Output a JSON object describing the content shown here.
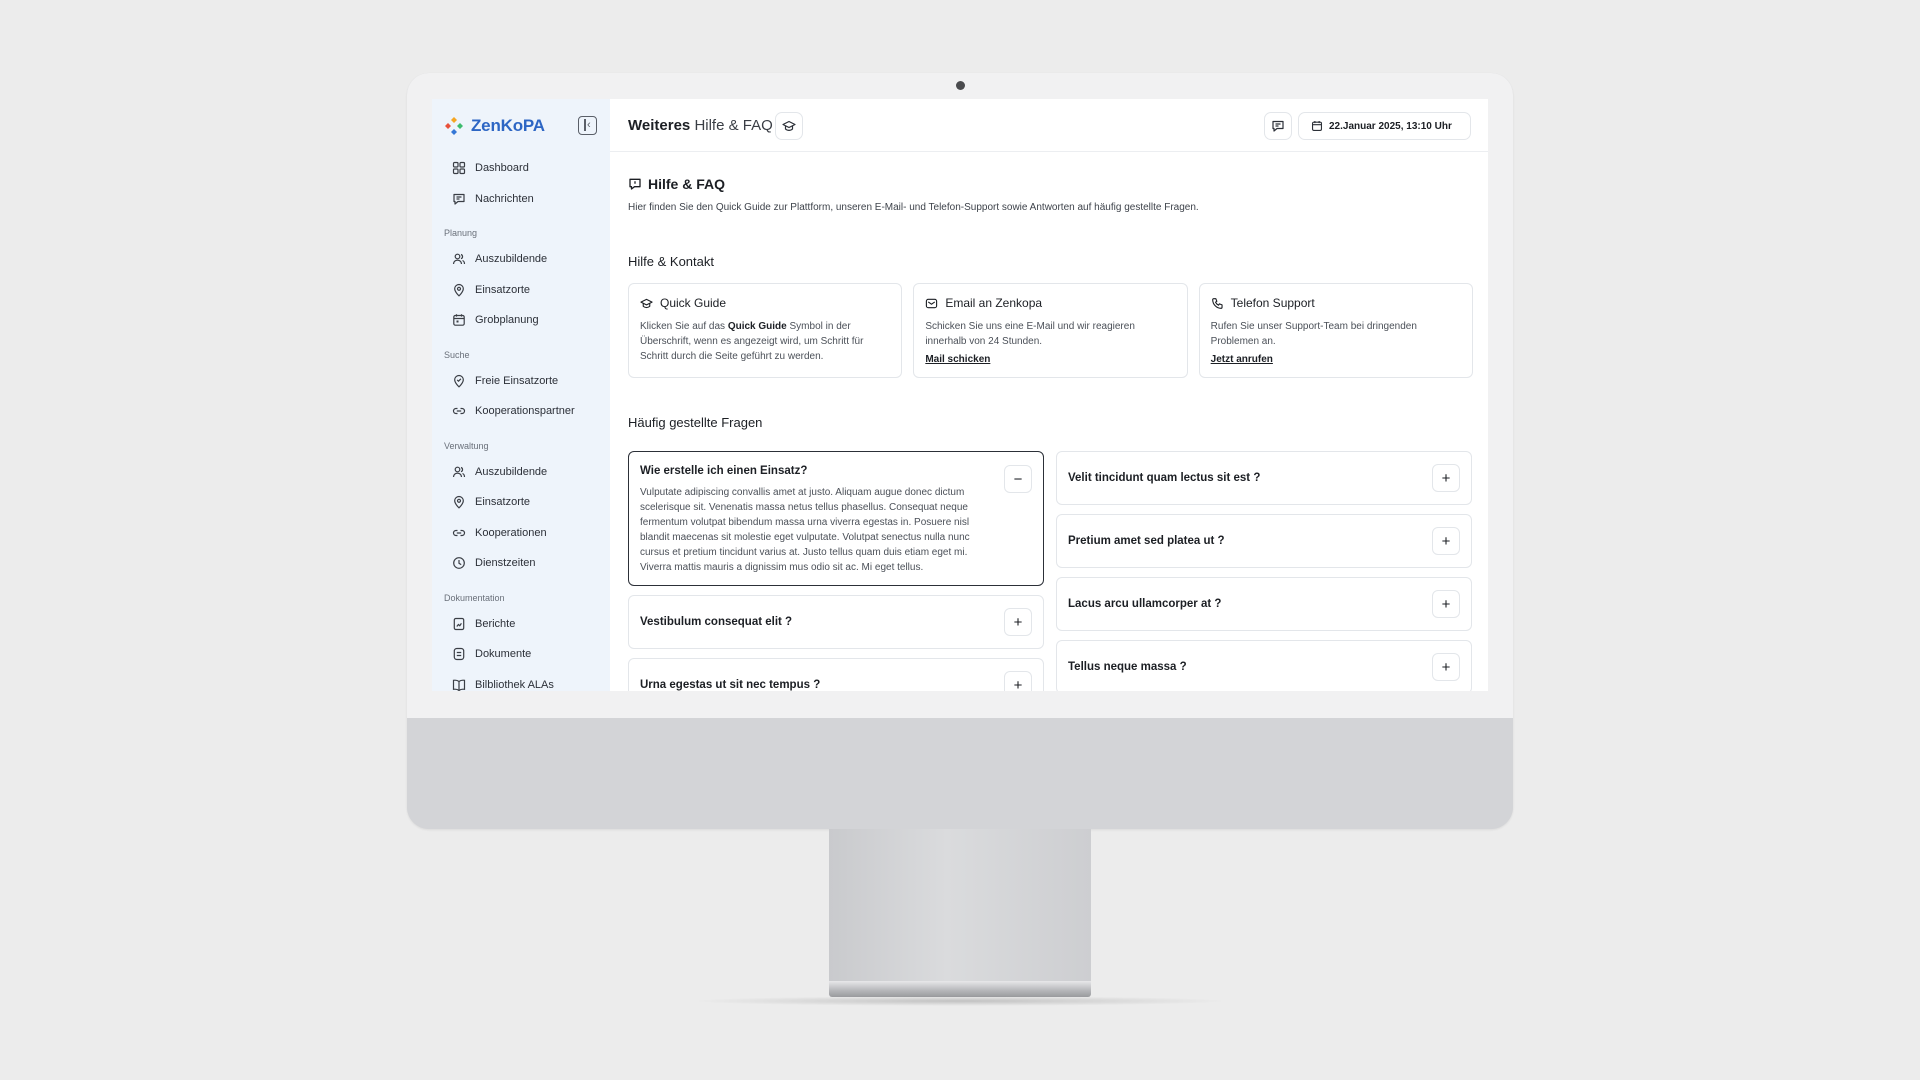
{
  "brand": {
    "name": "ZenKoPA"
  },
  "sidebar": {
    "top_items": [
      {
        "label": "Dashboard",
        "icon": "grid-icon"
      },
      {
        "label": "Nachrichten",
        "icon": "message-icon"
      }
    ],
    "sections": [
      {
        "title": "Planung",
        "items": [
          {
            "label": "Auszubildende",
            "icon": "users-icon"
          },
          {
            "label": "Einsatzorte",
            "icon": "location-pin-icon"
          },
          {
            "label": "Grobplanung",
            "icon": "calendar-plan-icon"
          }
        ]
      },
      {
        "title": "Suche",
        "items": [
          {
            "label": "Freie Einsatzorte",
            "icon": "location-check-icon"
          },
          {
            "label": "Kooperationspartner",
            "icon": "link-icon"
          }
        ]
      },
      {
        "title": "Verwaltung",
        "items": [
          {
            "label": "Auszubildende",
            "icon": "users-icon"
          },
          {
            "label": "Einsatzorte",
            "icon": "location-pin-icon"
          },
          {
            "label": "Kooperationen",
            "icon": "link-icon"
          },
          {
            "label": "Dienstzeiten",
            "icon": "clock-icon"
          }
        ]
      },
      {
        "title": "Dokumentation",
        "items": [
          {
            "label": "Berichte",
            "icon": "report-icon"
          },
          {
            "label": "Dokumente",
            "icon": "document-icon"
          },
          {
            "label": "Bilbliothek ALAs",
            "icon": "book-icon"
          }
        ]
      }
    ]
  },
  "header": {
    "title_bold": "Weiteres",
    "title_rest": "Hilfe & FAQ",
    "datetime": "22.Januar 2025, 13:10 Uhr"
  },
  "help": {
    "title": "Hilfe & FAQ",
    "description": "Hier finden Sie den Quick Guide zur Plattform, unseren E-Mail- und Telefon-Support sowie Antworten auf häufig gestellte Fragen.",
    "contact_heading": "Hilfe & Kontakt",
    "cards": {
      "quick_guide": {
        "title": "Quick Guide",
        "text_before": "Klicken Sie auf das ",
        "text_bold": "Quick Guide",
        "text_after": " Symbol in der Überschrift, wenn es angezeigt wird, um Schritt für Schritt durch die Seite geführt zu werden."
      },
      "email": {
        "title": "Email an Zenkopa",
        "text": "Schicken Sie uns eine E-Mail und wir reagieren innerhalb von 24 Stunden.",
        "link": "Mail schicken"
      },
      "phone": {
        "title": "Telefon Support",
        "text": "Rufen Sie unser Support-Team bei dringenden Problemen an.",
        "link": "Jetzt anrufen"
      }
    }
  },
  "faq": {
    "heading": "Häufig gestellte Fragen",
    "open_question": "Wie erstelle ich einen Einsatz?",
    "open_answer": "Vulputate adipiscing convallis amet at justo. Aliquam augue donec dictum scelerisque sit. Venenatis massa netus tellus phasellus. Consequat neque fermentum volutpat bibendum massa urna viverra egestas in. Posuere nisl blandit maecenas sit molestie eget vulputate. Volutpat senectus nulla nunc cursus et pretium tincidunt varius at. Justo tellus quam duis etiam eget mi. Viverra mattis mauris a dignissim mus odio sit ac. Mi eget tellus.",
    "left": [
      "Vestibulum consequat elit ?",
      "Urna egestas ut sit nec tempus ?"
    ],
    "right": [
      "Velit tincidunt quam lectus sit est ?",
      "Pretium amet sed platea ut ?",
      "Lacus arcu ullamcorper at ?",
      "Tellus neque massa ?"
    ],
    "toggle_open": "−",
    "toggle_closed": "+"
  }
}
